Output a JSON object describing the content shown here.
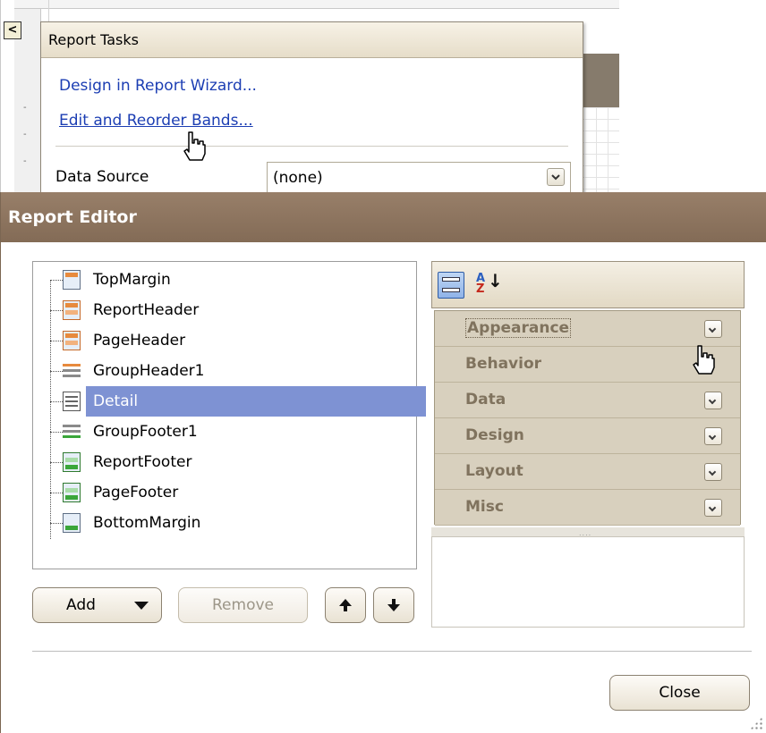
{
  "tasks": {
    "title": "Report Tasks",
    "smart_tag_glyph": "<",
    "links": [
      "Design in Report Wizard...",
      "Edit and Reorder Bands..."
    ],
    "data_source_label": "Data Source",
    "data_source_value": "(none)"
  },
  "editor": {
    "title": "Report Editor",
    "bands": [
      {
        "label": "TopMargin",
        "icon": "top-margin-icon"
      },
      {
        "label": "ReportHeader",
        "icon": "report-header-icon"
      },
      {
        "label": "PageHeader",
        "icon": "page-header-icon"
      },
      {
        "label": "GroupHeader1",
        "icon": "group-header-icon"
      },
      {
        "label": "Detail",
        "icon": "detail-band-icon",
        "selected": true
      },
      {
        "label": "GroupFooter1",
        "icon": "group-footer-icon"
      },
      {
        "label": "ReportFooter",
        "icon": "report-footer-icon"
      },
      {
        "label": "PageFooter",
        "icon": "page-footer-icon"
      },
      {
        "label": "BottomMargin",
        "icon": "bottom-margin-icon"
      }
    ],
    "buttons": {
      "add": "Add",
      "remove": "Remove",
      "up": "🡅",
      "down": "🡇",
      "close": "Close"
    },
    "property_grid": {
      "toolbar": [
        "categorized-icon",
        "alphabetical-sort-icon"
      ],
      "alpha_a": "A",
      "alpha_z": "Z",
      "alpha_arrow": "↓",
      "categories": [
        "Appearance",
        "Behavior",
        "Data",
        "Design",
        "Layout",
        "Misc"
      ],
      "splitter": "....",
      "focused_category": "Appearance"
    }
  },
  "colors": {
    "editor_title_bg": "#8d7560",
    "selection": "#7e92d3",
    "link": "#1c3eb3",
    "category_text": "#80735e"
  }
}
